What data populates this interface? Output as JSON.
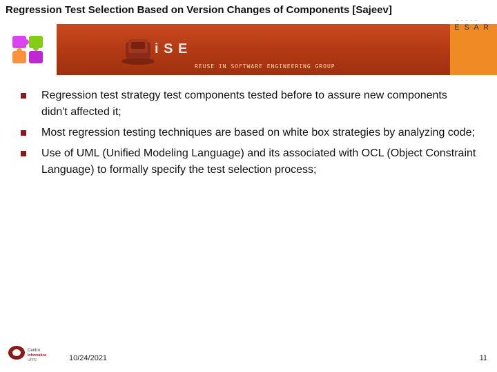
{
  "title": "Regression Test Selection Based on Version Changes of Components [Sajeev]",
  "logos": {
    "cesar_dots": ". . . . .",
    "cesar_text": "C E S A R",
    "banner_rise": "R i S E",
    "banner_sub": "REUSE IN SOFTWARE ENGINEERING GROUP"
  },
  "bullets": [
    "Regression test strategy test components tested before to assure new components didn't affected it;",
    "Most regression testing techniques are based on white box strategies by analyzing code;",
    "Use of UML (Unified Modeling Language) and its associated with OCL (Object Constraint Language) to formally specify the test selection process;"
  ],
  "footer": {
    "date": "10/24/2021",
    "page": "11"
  }
}
